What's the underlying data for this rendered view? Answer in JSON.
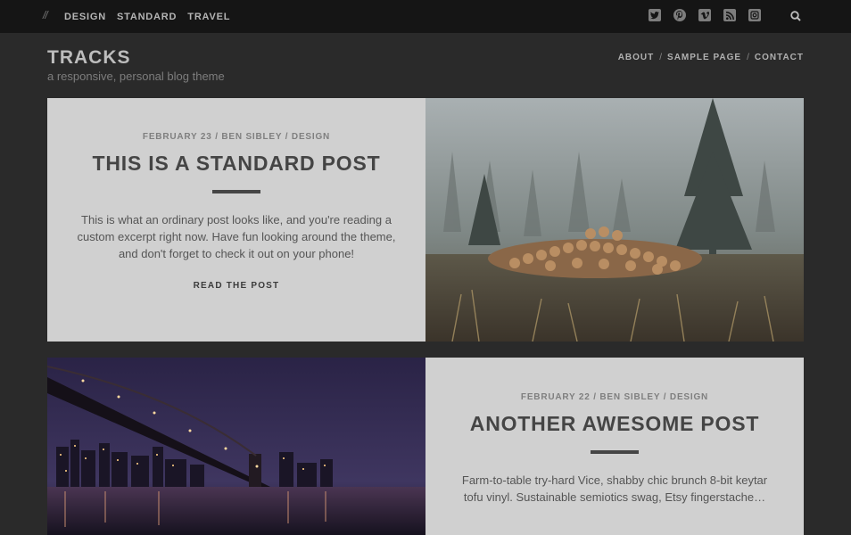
{
  "topbar": {
    "slashes": "//",
    "categories": [
      "DESIGN",
      "STANDARD",
      "TRAVEL"
    ],
    "social_icons": [
      "twitter-icon",
      "pinterest-icon",
      "vimeo-icon",
      "rss-icon",
      "instagram-icon"
    ],
    "search_icon": "search-icon"
  },
  "site": {
    "title": "TRACKS",
    "tagline": "a responsive, personal blog theme"
  },
  "nav": {
    "items": [
      "ABOUT",
      "SAMPLE PAGE",
      "CONTACT"
    ],
    "separator": "/"
  },
  "posts": [
    {
      "meta": "FEBRUARY 23 / BEN SIBLEY / DESIGN",
      "title": "THIS IS A STANDARD POST",
      "excerpt": "This is what an ordinary post looks like, and you're reading a custom excerpt right now. Have fun looking around the theme, and don't forget to check it out on your phone!",
      "more": "READ THE POST"
    },
    {
      "meta": "FEBRUARY 22 / BEN SIBLEY / DESIGN",
      "title": "ANOTHER AWESOME POST",
      "excerpt": "Farm-to-table try-hard Vice, shabby chic brunch 8-bit keytar tofu vinyl. Sustainable semiotics swag, Etsy fingerstache…"
    }
  ],
  "colors": {
    "page_bg": "#2a2a2a",
    "topbar_bg": "#151515",
    "card_bg": "#d0d0d0",
    "title_text": "#454545"
  }
}
